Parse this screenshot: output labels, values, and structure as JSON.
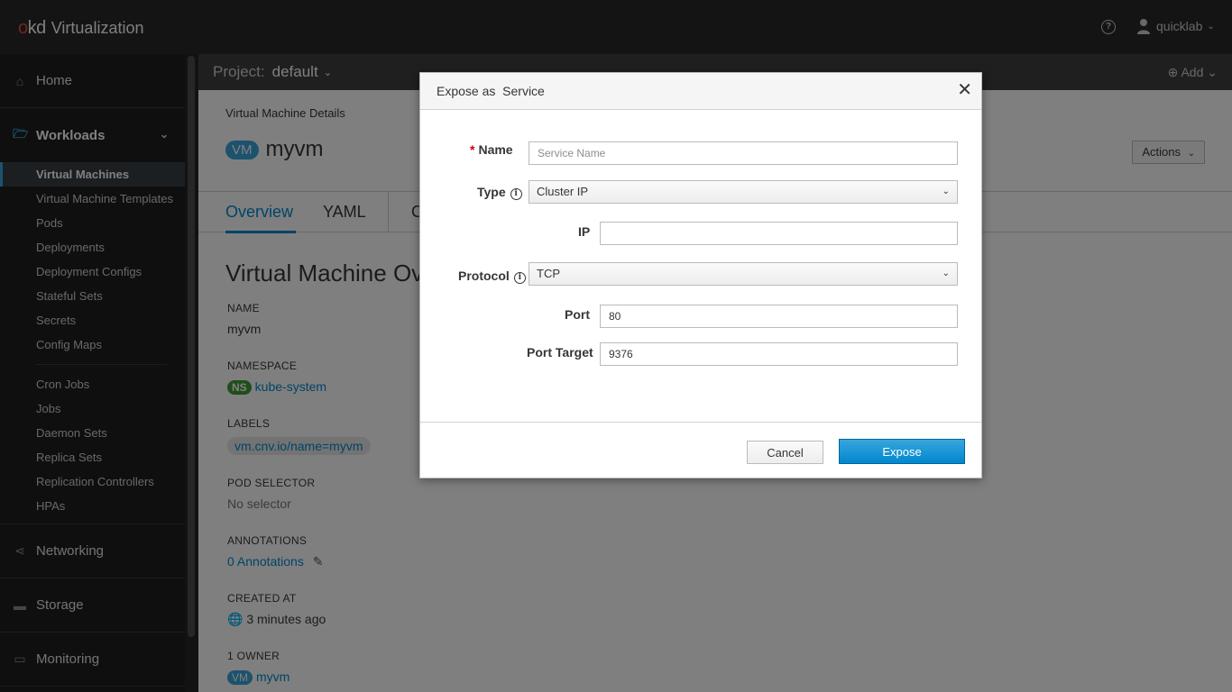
{
  "masthead": {
    "brand_logo": "okd",
    "brand_name": "Virtualization",
    "help_icon": "?",
    "user_name": "quicklab"
  },
  "sidebar": {
    "sections": [
      {
        "label": "Home",
        "icon": "home-icon"
      },
      {
        "label": "Workloads",
        "icon": "folder-open-icon"
      },
      {
        "label": "Networking",
        "icon": "network-icon"
      },
      {
        "label": "Storage",
        "icon": "storage-icon"
      },
      {
        "label": "Monitoring",
        "icon": "monitor-icon"
      }
    ],
    "workloads_items": [
      "Virtual Machines",
      "Virtual Machine Templates",
      "Pods",
      "Deployments",
      "Deployment Configs",
      "Stateful Sets",
      "Secrets",
      "Config Maps",
      "Cron Jobs",
      "Jobs",
      "Daemon Sets",
      "Replica Sets",
      "Replication Controllers",
      "HPAs"
    ]
  },
  "project_bar": {
    "label": "Project:",
    "value": "default",
    "add_label": "Add"
  },
  "page": {
    "breadcrumb": "Virtual Machine Details",
    "badge": "VM",
    "title": "myvm",
    "actions_label": "Actions",
    "tabs": [
      "Overview",
      "YAML",
      "C"
    ],
    "overview_heading": "Virtual Machine Ov",
    "fields": {
      "name_key": "NAME",
      "name_value": "myvm",
      "namespace_key": "NAMESPACE",
      "namespace_badge": "NS",
      "namespace_value": "kube-system",
      "labels_key": "LABELS",
      "labels_value": "vm.cnv.io/name=myvm",
      "pod_selector_key": "POD SELECTOR",
      "pod_selector_value": "No selector",
      "annotations_key": "ANNOTATIONS",
      "annotations_value": "0 Annotations",
      "created_key": "CREATED AT",
      "created_value": "3 minutes ago",
      "owner_key": "1 OWNER",
      "owner_badge": "VM",
      "owner_value": "myvm"
    }
  },
  "modal": {
    "title": "Expose as  Service",
    "name_label": "Name",
    "name_placeholder": "Service Name",
    "name_value": "",
    "type_label": "Type",
    "type_value": "Cluster IP",
    "ip_label": "IP",
    "ip_value": "",
    "protocol_label": "Protocol",
    "protocol_value": "TCP",
    "port_label": "Port",
    "port_value": "80",
    "port_target_label": "Port Target",
    "port_target_value": "9376",
    "cancel_label": "Cancel",
    "expose_label": "Expose"
  },
  "colors": {
    "masthead": "#292929",
    "sidebar": "#1f1f1f",
    "accent": "#0088ce",
    "primary_button": "#0088ce"
  }
}
